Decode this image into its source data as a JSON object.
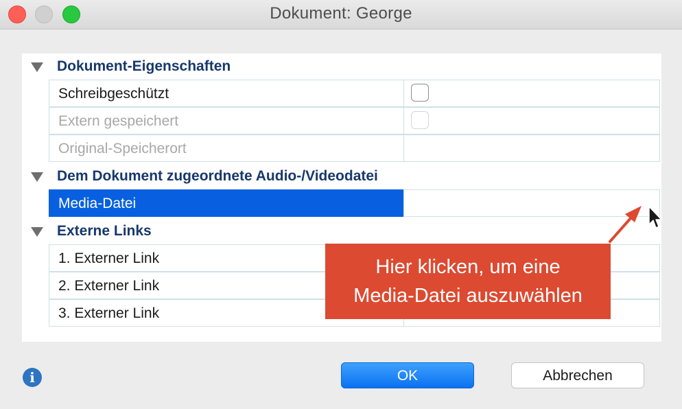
{
  "window": {
    "title": "Dokument:  George"
  },
  "sections": [
    {
      "label": "Dokument-Eigenschaften",
      "rows": [
        {
          "label": "Schreibgeschützt",
          "value_type": "checkbox",
          "checked": false,
          "disabled": false
        },
        {
          "label": "Extern gespeichert",
          "value_type": "checkbox",
          "checked": false,
          "disabled": true
        },
        {
          "label": "Original-Speicherort",
          "value": "",
          "disabled": true
        }
      ]
    },
    {
      "label": "Dem Dokument zugeordnete Audio-/Videodatei",
      "rows": [
        {
          "label": "Media-Datei",
          "value": "",
          "selected": true
        }
      ]
    },
    {
      "label": "Externe Links",
      "rows": [
        {
          "label": "1. Externer Link",
          "value": ""
        },
        {
          "label": "2. Externer Link",
          "value": ""
        },
        {
          "label": "3. Externer Link",
          "value": ""
        }
      ]
    }
  ],
  "callout": {
    "line1": "Hier klicken, um eine",
    "line2": "Media-Datei auszuwählen",
    "color": "#dc4a31"
  },
  "buttons": {
    "ok": "OK",
    "cancel": "Abbrechen"
  },
  "icons": {
    "info": "i"
  },
  "colors": {
    "accent": "#0860e0",
    "section_header": "#17386b"
  }
}
